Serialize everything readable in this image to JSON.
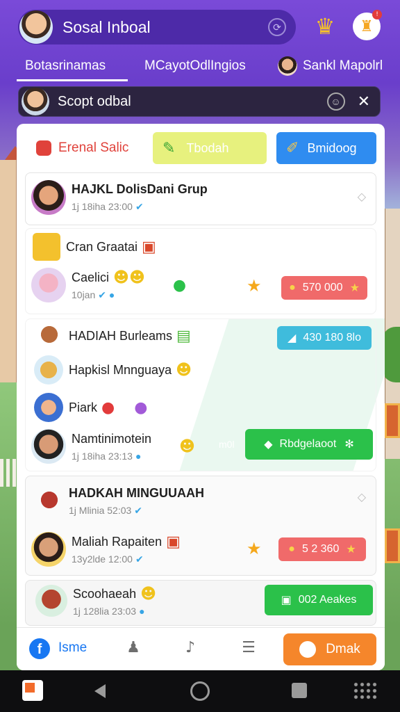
{
  "header": {
    "title": "Sosal Inboal",
    "sync_icon": "sync-icon",
    "crown_icon": "crown-icon",
    "notification_badge": "!"
  },
  "tabs": [
    {
      "label": "Botasrinamas",
      "active": true
    },
    {
      "label": "MCayotOdlIngios",
      "active": false
    },
    {
      "label": "Sankl Mapolrl",
      "active": false
    }
  ],
  "search": {
    "placeholder": "Scopt odbal"
  },
  "actions": {
    "filter_label": "Erenal Salic",
    "button_yellow": "Tbodah",
    "button_blue": "Bmidoog"
  },
  "threads": [
    {
      "name": "HAJKL DolisDani Grup",
      "meta": "1j 18iha 23:00"
    },
    {
      "name": "Cran Graatai"
    },
    {
      "name": "Caelici",
      "meta": "10jan",
      "pill": "570 000"
    },
    {
      "name": "HADIAH Burleams",
      "pill": "430 180 8lo"
    },
    {
      "name": "Hapkisl Mnnguaya"
    },
    {
      "name": "Piark"
    },
    {
      "name": "Namtinimotein",
      "meta": "1j 18iha 23:13",
      "pill_prefix": "m0l",
      "pill": "Rbdgelaoot"
    },
    {
      "name": "HADKAH MINGUUAAH",
      "meta": "1j Mlinia 52:03"
    },
    {
      "name": "Maliah Rapaiten",
      "meta": "13y2lde 12:00",
      "pill": "5 2 360"
    },
    {
      "name": "Scoohaeah",
      "meta": "1j 128lia 23:03",
      "pill": "002 Aeakes"
    }
  ],
  "bottom_nav": {
    "home_label": "Isme",
    "cta_label": "Dmak"
  },
  "colors": {
    "brand_purple": "#6b3fd0",
    "accent_blue": "#2f8cf0",
    "accent_green": "#2bc14a",
    "accent_orange": "#f5862b",
    "accent_red": "#f06a6a"
  }
}
